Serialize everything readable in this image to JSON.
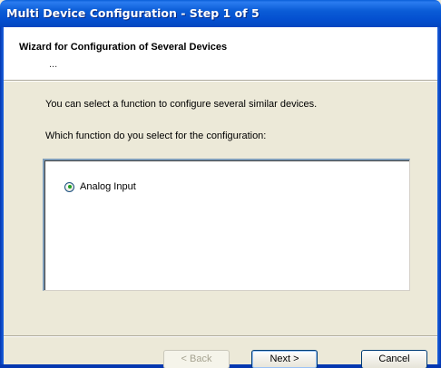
{
  "window": {
    "title": "Multi Device Configuration - Step 1 of 5"
  },
  "header": {
    "title": "Wizard for Configuration of Several Devices",
    "subtitle": "..."
  },
  "body": {
    "instruction_1": "You can select a function to configure several similar devices.",
    "instruction_2": "Which function do you select for the configuration:"
  },
  "functions": {
    "options": [
      {
        "label": "Analog Input",
        "selected": true
      }
    ]
  },
  "buttons": {
    "back": {
      "label": "< Back",
      "enabled": false
    },
    "next": {
      "label": "Next >",
      "enabled": true
    },
    "cancel": {
      "label": "Cancel",
      "enabled": true
    }
  },
  "colors": {
    "titlebar": "#0a5cd6",
    "dialog_bg": "#ece9d8",
    "radio_selected": "#21a121"
  }
}
